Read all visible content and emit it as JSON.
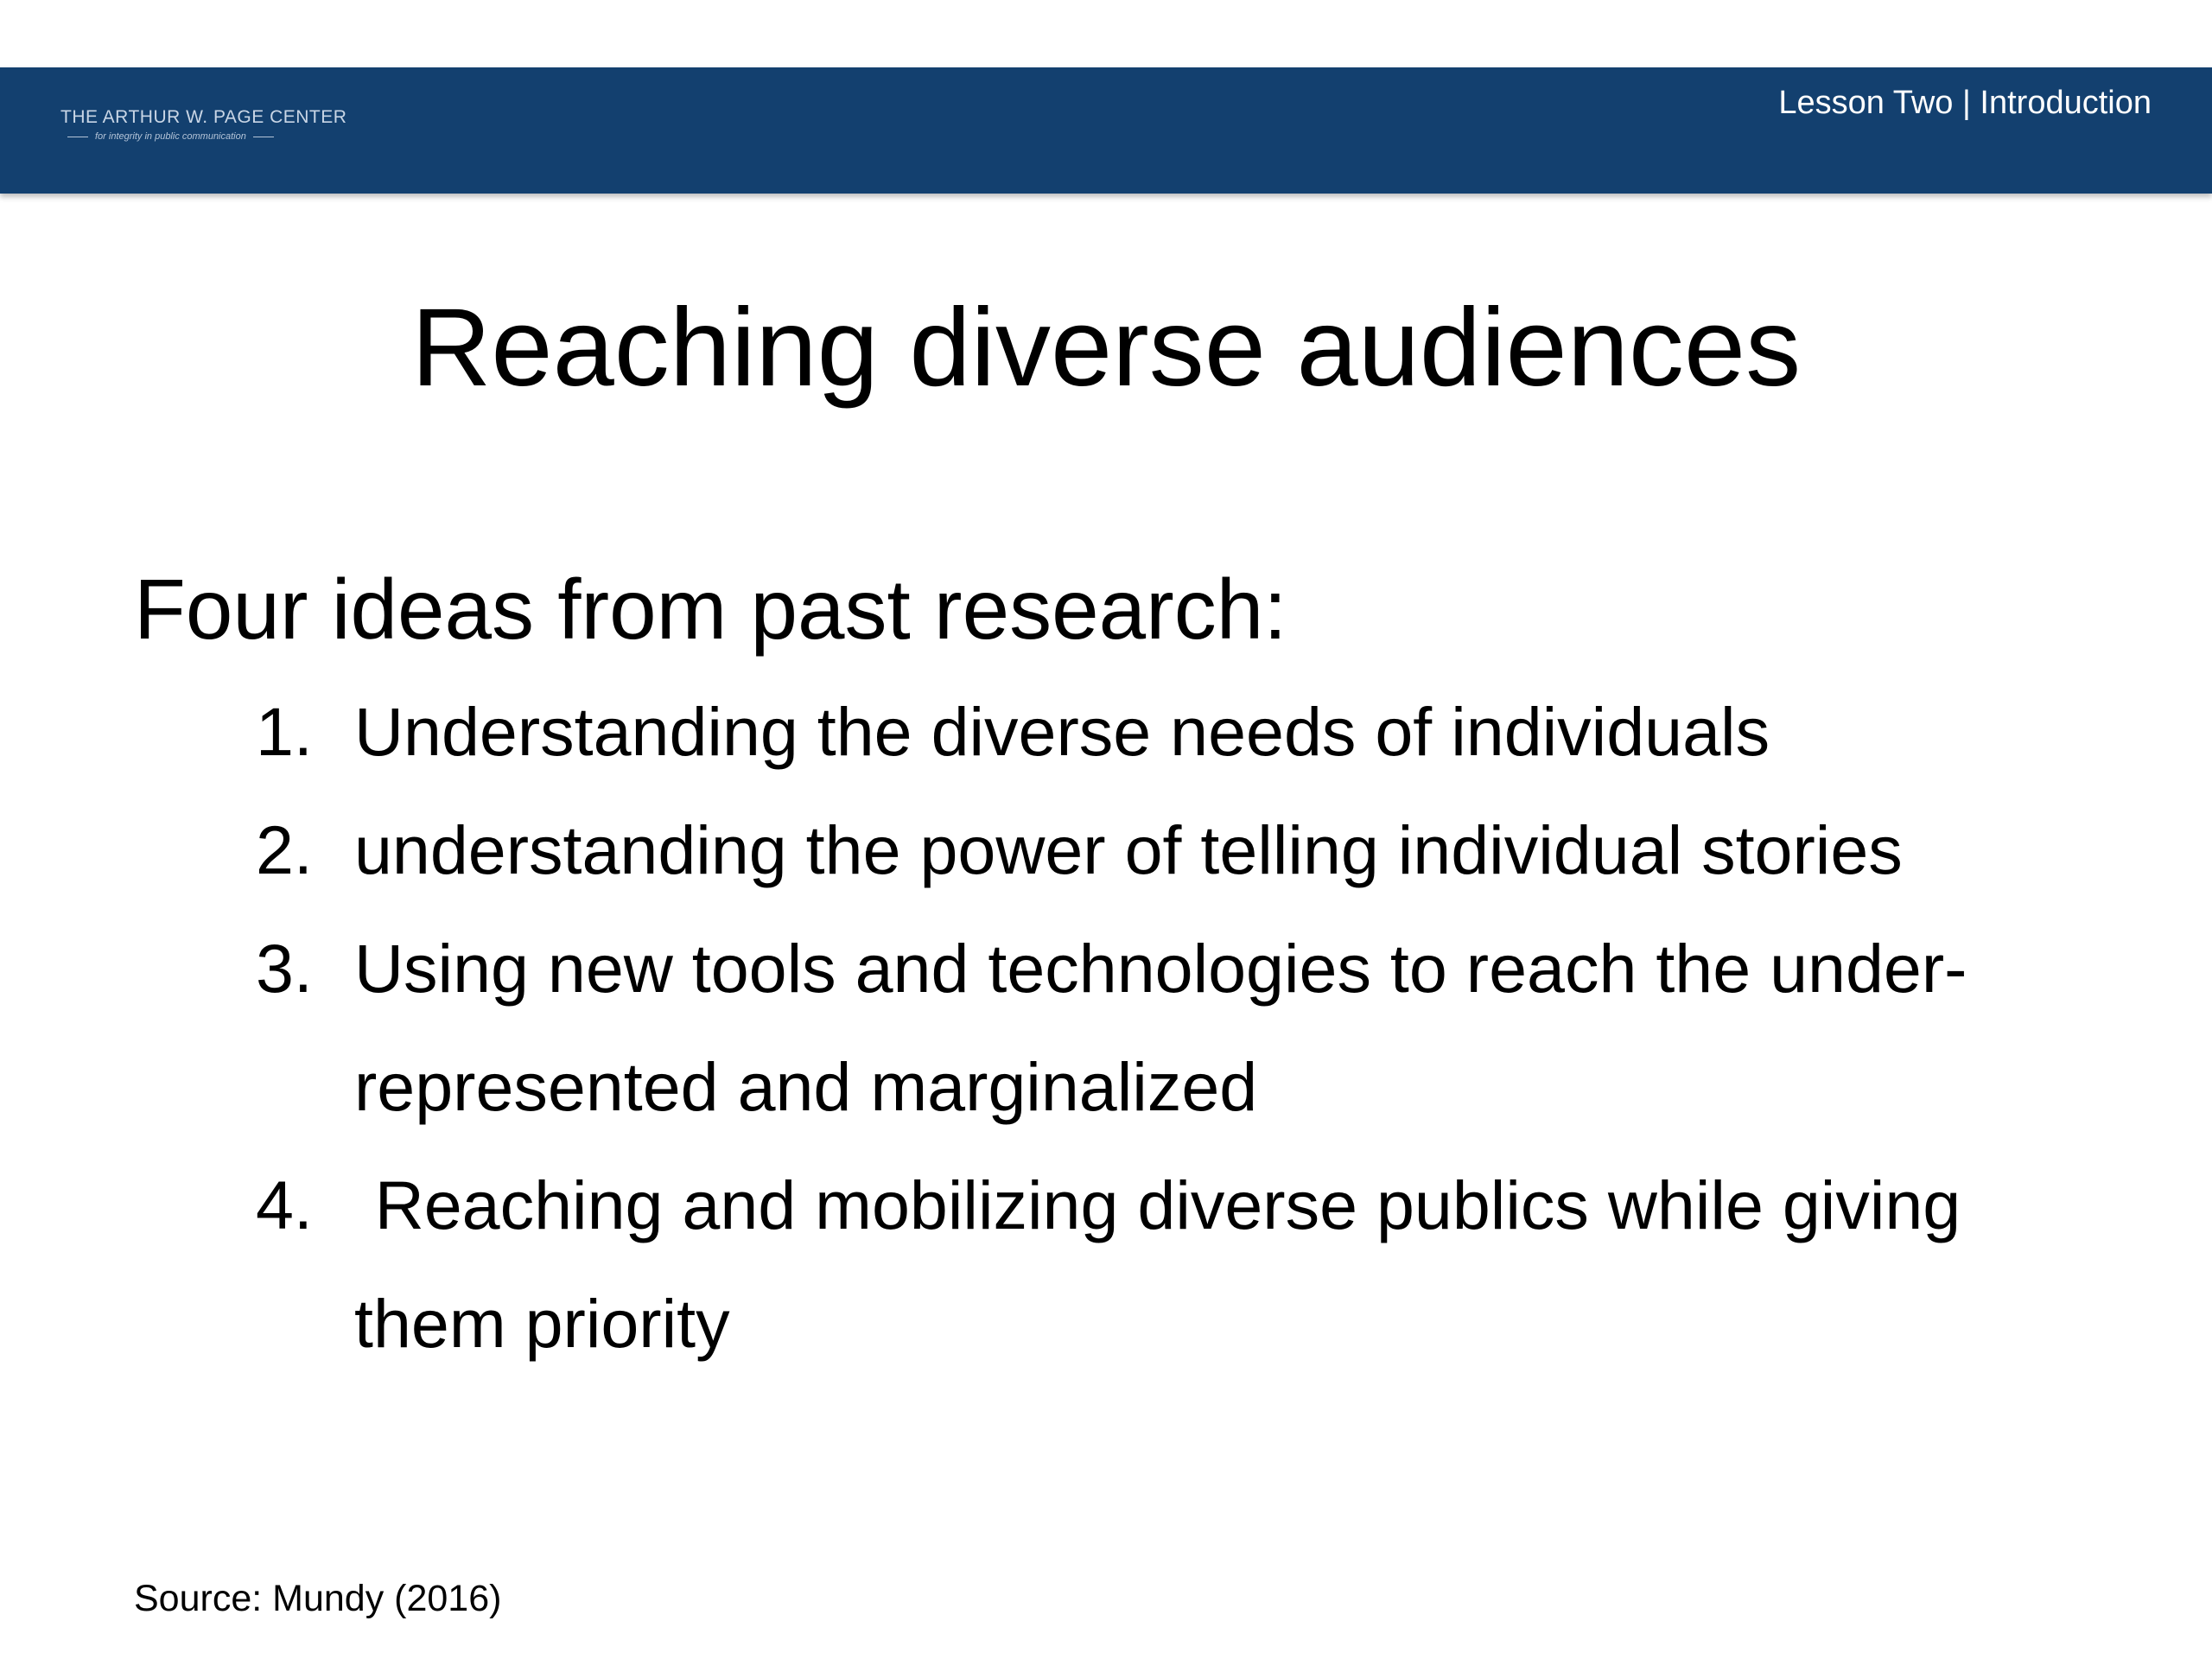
{
  "header": {
    "logo_main": "THE ARTHUR W. PAGE CENTER",
    "logo_sub": "for integrity in public communication",
    "lesson_label": "Lesson Two | Introduction",
    "background_color": "#13406f"
  },
  "slide": {
    "title": "Reaching diverse audiences",
    "intro": "Four ideas from past research:",
    "ideas": [
      {
        "number": "1.",
        "text": "Understanding the diverse needs of individuals"
      },
      {
        "number": "2.",
        "text": "understanding the power of telling individual stories"
      },
      {
        "number": "3.",
        "text": "Using new tools and technologies to reach the under-represented and marginalized"
      },
      {
        "number": "4.",
        "text": "Reaching and mobilizing diverse publics while giving them priority"
      }
    ],
    "source": "Source: Mundy (2016)"
  }
}
